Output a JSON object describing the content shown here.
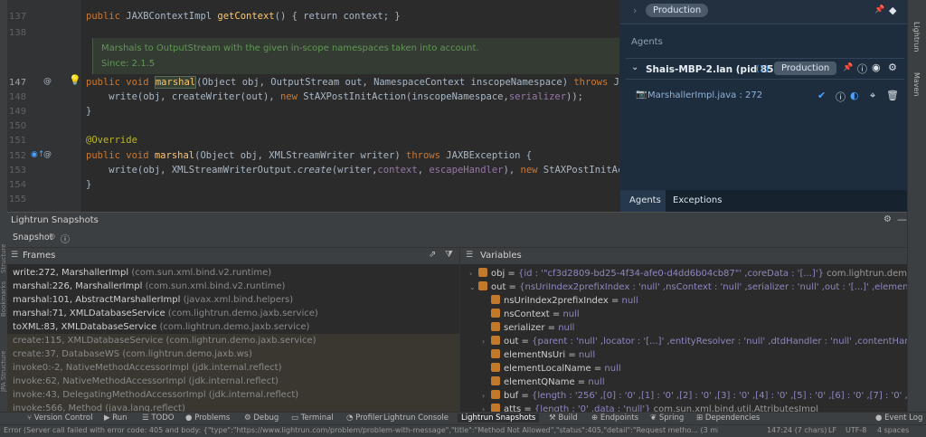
{
  "editor": {
    "lines": [
      {
        "num": "137",
        "text_kw": "public",
        "text_rest": " JAXBContextImpl ",
        "fn": "getContext",
        "tail": "() { return context; }"
      },
      {
        "num": "138"
      },
      {
        "num": "",
        "doc": "Marshals to OutputStream with the given in-scope namespaces taken into account."
      },
      {
        "num": "",
        "doc": "Since: 2.1.5"
      },
      {
        "num": "147",
        "code": "public void marshal(Object obj, OutputStream out, NamespaceContext inscopeNamespace) throws JAXBExcept"
      },
      {
        "num": "148",
        "code": "    write(obj, createWriter(out), new StAXPostInitAction(inscopeNamespace,serializer));"
      },
      {
        "num": "149",
        "code": "}"
      },
      {
        "num": "150"
      },
      {
        "num": "151",
        "code": "@Override"
      },
      {
        "num": "152",
        "code": "public void marshal(Object obj, XMLStreamWriter writer) throws JAXBException {"
      },
      {
        "num": "153",
        "code": "    write(obj, XMLStreamWriterOutput.create(writer,context, escapeHandler), new StAXPostInitAction(writ"
      },
      {
        "num": "154",
        "code": "}"
      },
      {
        "num": "155"
      }
    ]
  },
  "lightrun": {
    "production_pill": "Production",
    "agents_label": "Agents",
    "agent_name": "Shais-MBP-2.lan (pid 8591)",
    "agent_count": "(1)",
    "agent_pill": "Production",
    "snapshot_item": "MarshallerImpl.java : 272",
    "tabs": [
      "Agents",
      "Exceptions"
    ]
  },
  "right_strip": {
    "label1": "Lightrun",
    "label2": "Maven"
  },
  "left_strip": {
    "label1": "Structure",
    "label2": "Bookmarks",
    "label3": "JPA Structure"
  },
  "toolwindow": {
    "title": "Lightrun Snapshots",
    "tab": "Snapshot",
    "frames_header": "Frames",
    "variables_header": "Variables",
    "frames": [
      {
        "name": "write:272, MarshallerImpl",
        "pkg": "(com.sun.xml.bind.v2.runtime)",
        "lib": false
      },
      {
        "name": "marshal:226, MarshallerImpl",
        "pkg": "(com.sun.xml.bind.v2.runtime)",
        "lib": false
      },
      {
        "name": "marshal:101, AbstractMarshallerImpl",
        "pkg": "(javax.xml.bind.helpers)",
        "lib": false
      },
      {
        "name": "marshal:71, XMLDatabaseService",
        "pkg": "(com.lightrun.demo.jaxb.service)",
        "lib": false
      },
      {
        "name": "toXML:83, XMLDatabaseService",
        "pkg": "(com.lightrun.demo.jaxb.service)",
        "lib": false
      },
      {
        "name": "create:115, XMLDatabaseService",
        "pkg": "(com.lightrun.demo.jaxb.service)",
        "lib": true
      },
      {
        "name": "create:37, DatabaseWS",
        "pkg": "(com.lightrun.demo.jaxb.ws)",
        "lib": true
      },
      {
        "name": "invoke0:-2, NativeMethodAccessorImpl",
        "pkg": "(jdk.internal.reflect)",
        "lib": true
      },
      {
        "name": "invoke:62, NativeMethodAccessorImpl",
        "pkg": "(jdk.internal.reflect)",
        "lib": true
      },
      {
        "name": "invoke:43, DelegatingMethodAccessorImpl",
        "pkg": "(jdk.internal.reflect)",
        "lib": true
      },
      {
        "name": "invoke:566, Method",
        "pkg": "(java.lang.reflect)",
        "lib": true
      }
    ],
    "variables": [
      {
        "indent": 0,
        "arrow": "›",
        "name": "obj",
        "eq": " = ",
        "val": "{id : '\"cf3d2809-bd25-4f34-afe0-d4dd6b04cb87\"' ,coreData : '[...]'}",
        "grey": " com.lightrun.demo.jaxb.m"
      },
      {
        "indent": 0,
        "arrow": "⌄",
        "name": "out",
        "eq": " = ",
        "val": "{nsUriIndex2prefixIndex : 'null' ,nsContext : 'null' ,serializer : 'null' ,out : '[...]' ,elementNsUri : 'n",
        "grey": ""
      },
      {
        "indent": 1,
        "arrow": "",
        "name": "nsUriIndex2prefixIndex",
        "eq": " = ",
        "val": "null",
        "grey": ""
      },
      {
        "indent": 1,
        "arrow": "",
        "name": "nsContext",
        "eq": " = ",
        "val": "null",
        "grey": ""
      },
      {
        "indent": 1,
        "arrow": "",
        "name": "serializer",
        "eq": " = ",
        "val": "null",
        "grey": ""
      },
      {
        "indent": 1,
        "arrow": "›",
        "name": "out",
        "eq": " = ",
        "val": "{parent : 'null' ,locator : '[...]' ,entityResolver : 'null' ,dtdHandler : 'null' ,contentHandler : 'null",
        "grey": ""
      },
      {
        "indent": 1,
        "arrow": "",
        "name": "elementNsUri",
        "eq": " = ",
        "val": "null",
        "grey": ""
      },
      {
        "indent": 1,
        "arrow": "",
        "name": "elementLocalName",
        "eq": " = ",
        "val": "null",
        "grey": ""
      },
      {
        "indent": 1,
        "arrow": "",
        "name": "elementQName",
        "eq": " = ",
        "val": "null",
        "grey": ""
      },
      {
        "indent": 1,
        "arrow": "›",
        "name": "buf",
        "eq": " = ",
        "val": "{length : '256' ,[0] : '0' ,[1] : '0' ,[2] : '0' ,[3] : '0' ,[4] : '0' ,[5] : '0' ,[6] : '0' ,[7] : '0' ,[8] : '0'",
        "grey": ""
      },
      {
        "indent": 1,
        "arrow": "›",
        "name": "atts",
        "eq": " = ",
        "val": "{length : '0' ,data : 'null'}",
        "grey": " com.sun.xml.bind.util.AttributesImpl"
      }
    ]
  },
  "bottom_tabs": [
    "Version Control",
    "Run",
    "TODO",
    "Problems",
    "Debug",
    "Terminal",
    "Profiler",
    "Lightrun Console",
    "Lightrun Snapshots",
    "Build",
    "Endpoints",
    "Spring",
    "Dependencies",
    "Event Log"
  ],
  "status": {
    "message": "Error (Server call failed with error code: 405 and body: {\"type\":\"https://www.lightrun.com/problem/problem-with-message\",\"title\":\"Method Not Allowed\",\"status\":405,\"detail\":\"Request metho... (3 minutes ago)",
    "position": "147:24 (7 chars)",
    "line_sep": "LF",
    "encoding": "UTF-8",
    "indent": "4 spaces"
  },
  "colors": {
    "accent": "#4aa3ff",
    "editor_bg": "#2b2b2b",
    "panel_bg": "#1e2d3d"
  }
}
